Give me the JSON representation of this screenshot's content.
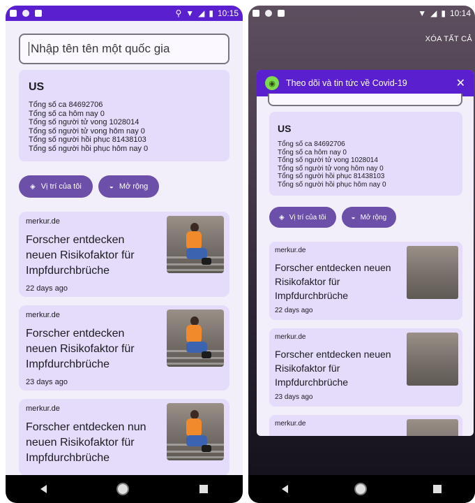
{
  "left": {
    "status": {
      "time": "10:15"
    },
    "search": {
      "placeholder": "Nhập tên tên một quốc gia"
    },
    "stats": {
      "country": "US",
      "lines": [
        "Tổng số ca 84692706",
        "Tổng số ca hôm nay 0",
        "Tổng số người tử vong 1028014",
        "Tổng số người tử vong hôm nay 0",
        "Tổng số người hồi phục 81438103",
        "Tổng số người hồi phục hôm nay 0"
      ]
    },
    "buttons": {
      "location": "Vị trí của tôi",
      "expand": "Mở rộng"
    },
    "news": [
      {
        "source": "merkur.de",
        "title": "Forscher entdecken neuen Risikofaktor für Impfdurchbrüche",
        "ago": "22 days ago"
      },
      {
        "source": "merkur.de",
        "title": "Forscher entdecken neuen Risikofaktor für Impfdurchbrüche",
        "ago": "23 days ago"
      },
      {
        "source": "merkur.de",
        "title": "Forscher entdecken nun neuen Risikofaktor für Impfdurchbrüche",
        "ago": ""
      }
    ]
  },
  "right": {
    "status": {
      "time": "10:14"
    },
    "clear_all": "XÓA TẤT CẢ",
    "notification": {
      "title": "Theo dõi và tin tức về Covid-19",
      "stats": {
        "country": "US",
        "lines": [
          "Tổng số ca 84692706",
          "Tổng số ca hôm nay 0",
          "Tổng số người tử vong 1028014",
          "Tổng số người tử vong hôm nay 0",
          "Tổng số người hồi phục 81438103",
          "Tổng số người hồi phục hôm nay 0"
        ]
      },
      "buttons": {
        "location": "Vị trí của tôi",
        "expand": "Mở rộng"
      },
      "news": [
        {
          "source": "merkur.de",
          "title": "Forscher entdecken neuen Risikofaktor für Impfdurchbrüche",
          "ago": "22 days ago"
        },
        {
          "source": "merkur.de",
          "title": "Forscher entdecken neuen Risikofaktor für Impfdurchbrüche",
          "ago": "23 days ago"
        },
        {
          "source": "merkur.de",
          "title": "",
          "ago": ""
        }
      ]
    }
  },
  "colors": {
    "accent": "#5a1fcf",
    "card": "#e5dbfb",
    "button": "#6b4fa8"
  }
}
